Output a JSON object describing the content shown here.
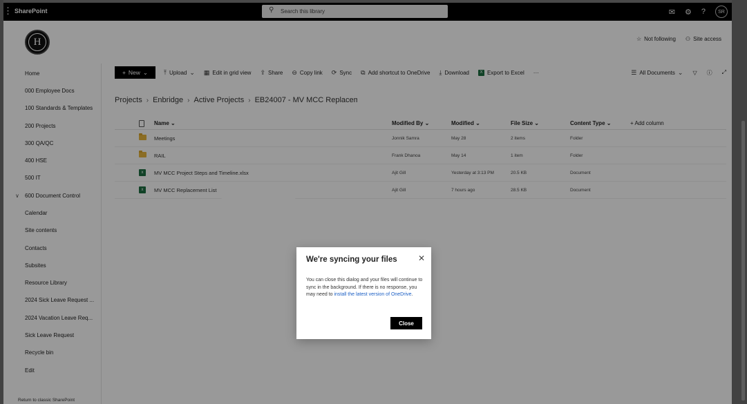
{
  "suite": {
    "app_name": "SharePoint",
    "search_placeholder": "Search this library",
    "avatar_initials": "SR"
  },
  "header": {
    "not_following": "Not following",
    "site_access": "Site access",
    "logo_letter": "H"
  },
  "nav": {
    "items": [
      "Home",
      "000 Employee Docs",
      "100 Standards & Templates",
      "200 Projects",
      "300 QA/QC",
      "400 HSE",
      "500 IT",
      "600 Document Control",
      "Calendar",
      "Site contents",
      "Contacts",
      "Subsites",
      "Resource Library",
      "2024 Sick Leave Request ...",
      "2024 Vacation Leave Req...",
      "Sick Leave Request",
      "Recycle bin",
      "Edit"
    ],
    "classic_link": "Return to classic SharePoint"
  },
  "commands": {
    "new": "New",
    "upload": "Upload",
    "edit_grid": "Edit in grid view",
    "share": "Share",
    "copy_link": "Copy link",
    "sync": "Sync",
    "add_shortcut": "Add shortcut to OneDrive",
    "download": "Download",
    "export_excel": "Export to Excel",
    "more": "···",
    "view": "All Documents"
  },
  "breadcrumb": [
    "Projects",
    "Enbridge",
    "Active Projects",
    "EB24007 - MV MCC Replacement"
  ],
  "list": {
    "columns": {
      "name": "Name",
      "modified_by": "Modified By",
      "modified": "Modified",
      "file_size": "File Size",
      "content_type": "Content Type",
      "add_column": "+ Add column"
    },
    "rows": [
      {
        "name": "Meetings",
        "modified_by": "Jonnik Samra",
        "modified": "May 28",
        "file_size": "2 items",
        "content_type": "Folder",
        "kind": "folder"
      },
      {
        "name": "RAIL",
        "modified_by": "Frank Dhanoa",
        "modified": "May 14",
        "file_size": "1 item",
        "content_type": "Folder",
        "kind": "folder"
      },
      {
        "name": "MV MCC Project Steps and Timeline.xlsx",
        "modified_by": "Ajit Gill",
        "modified": "Yesterday at 3:13 PM",
        "file_size": "20.5 KB",
        "content_type": "Document",
        "kind": "xlsx"
      },
      {
        "name": "MV MCC Replacement List",
        "modified_by": "Ajit Gill",
        "modified": "7 hours ago",
        "file_size": "28.5 KB",
        "content_type": "Document",
        "kind": "xlsx"
      }
    ]
  },
  "dialog": {
    "title": "We're syncing your files",
    "body": "You can close this dialog and your files will continue to sync in the background. If there is no response, you may need to ",
    "link": "install the latest version of OneDrive",
    "body_end": ".",
    "close_button": "Close"
  }
}
